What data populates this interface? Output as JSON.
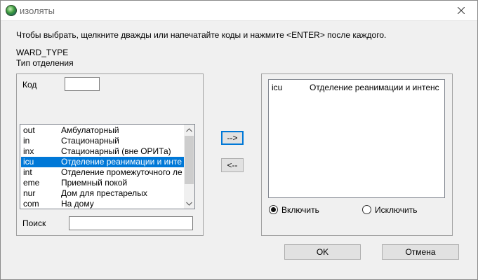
{
  "window": {
    "title": "изоляты",
    "close_icon": "close-icon"
  },
  "instruction": "Чтобы выбрать, щелкните дважды или напечатайте коды и нажмите <ENTER> после каждого.",
  "field": {
    "code": "WARD_TYPE",
    "description": "Тип отделения"
  },
  "left": {
    "code_label": "Код",
    "code_value": "",
    "search_label": "Поиск",
    "search_value": "",
    "items": [
      {
        "code": "out",
        "desc": "Амбулаторный",
        "selected": false
      },
      {
        "code": "in",
        "desc": "Стационарный",
        "selected": false
      },
      {
        "code": "inx",
        "desc": "Стационарный (вне ОРИТа)",
        "selected": false
      },
      {
        "code": "icu",
        "desc": "Отделение реанимации и инте",
        "selected": true
      },
      {
        "code": "int",
        "desc": "Отделение промежуточного ле",
        "selected": false
      },
      {
        "code": "eme",
        "desc": "Приемный покой",
        "selected": false
      },
      {
        "code": "nur",
        "desc": "Дом для престарелых",
        "selected": false
      },
      {
        "code": "com",
        "desc": "На дому",
        "selected": false
      }
    ]
  },
  "buttons": {
    "add": "-->",
    "remove": "<--",
    "ok": "OK",
    "cancel": "Отмена"
  },
  "right": {
    "selected_items": [
      {
        "code": "icu",
        "desc": "Отделение реанимации и интенс"
      }
    ],
    "include_label": "Включить",
    "exclude_label": "Исключить",
    "include_checked": true
  },
  "colors": {
    "selection": "#0078d7",
    "window_bg": "#f0f0f0"
  }
}
